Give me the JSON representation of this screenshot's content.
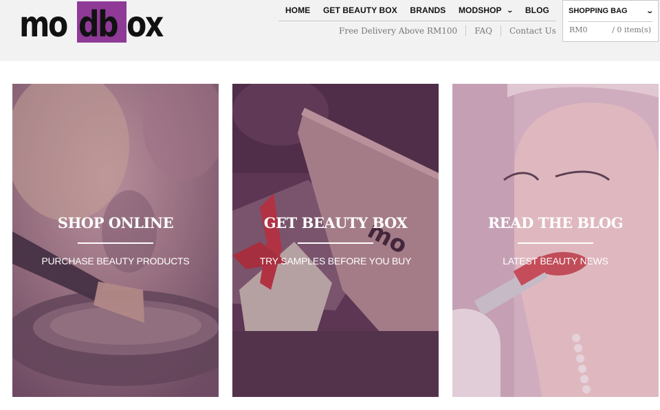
{
  "brand": {
    "logo_text": "modbox",
    "logo_left": "mo",
    "logo_box": "db",
    "logo_right": "ox",
    "accent_color": "#8e3a96"
  },
  "nav": {
    "items": [
      {
        "label": "HOME"
      },
      {
        "label": "GET BEAUTY BOX"
      },
      {
        "label": "BRANDS"
      },
      {
        "label": "MODSHOP"
      },
      {
        "label": "BLOG"
      }
    ],
    "modshop_icon": "chevron-down-icon"
  },
  "subnav": {
    "delivery": "Free Delivery Above RM100",
    "faq": "FAQ",
    "contact": "Contact Us"
  },
  "bag": {
    "title": "SHOPPING BAG",
    "total": "RM0",
    "items": "/ 0 item(s)",
    "icon": "chevron-down-icon"
  },
  "panels": [
    {
      "title": "SHOP ONLINE",
      "subtitle": "PURCHASE BEAUTY PRODUCTS",
      "image": "makeup-brush-photo"
    },
    {
      "title": "GET BEAUTY BOX",
      "subtitle": "TRY SAMPLES BEFORE YOU BUY",
      "image": "gift-box-photo"
    },
    {
      "title": "READ THE BLOG",
      "subtitle": "LATEST BEAUTY NEWS",
      "image": "lipstick-model-photo"
    }
  ]
}
